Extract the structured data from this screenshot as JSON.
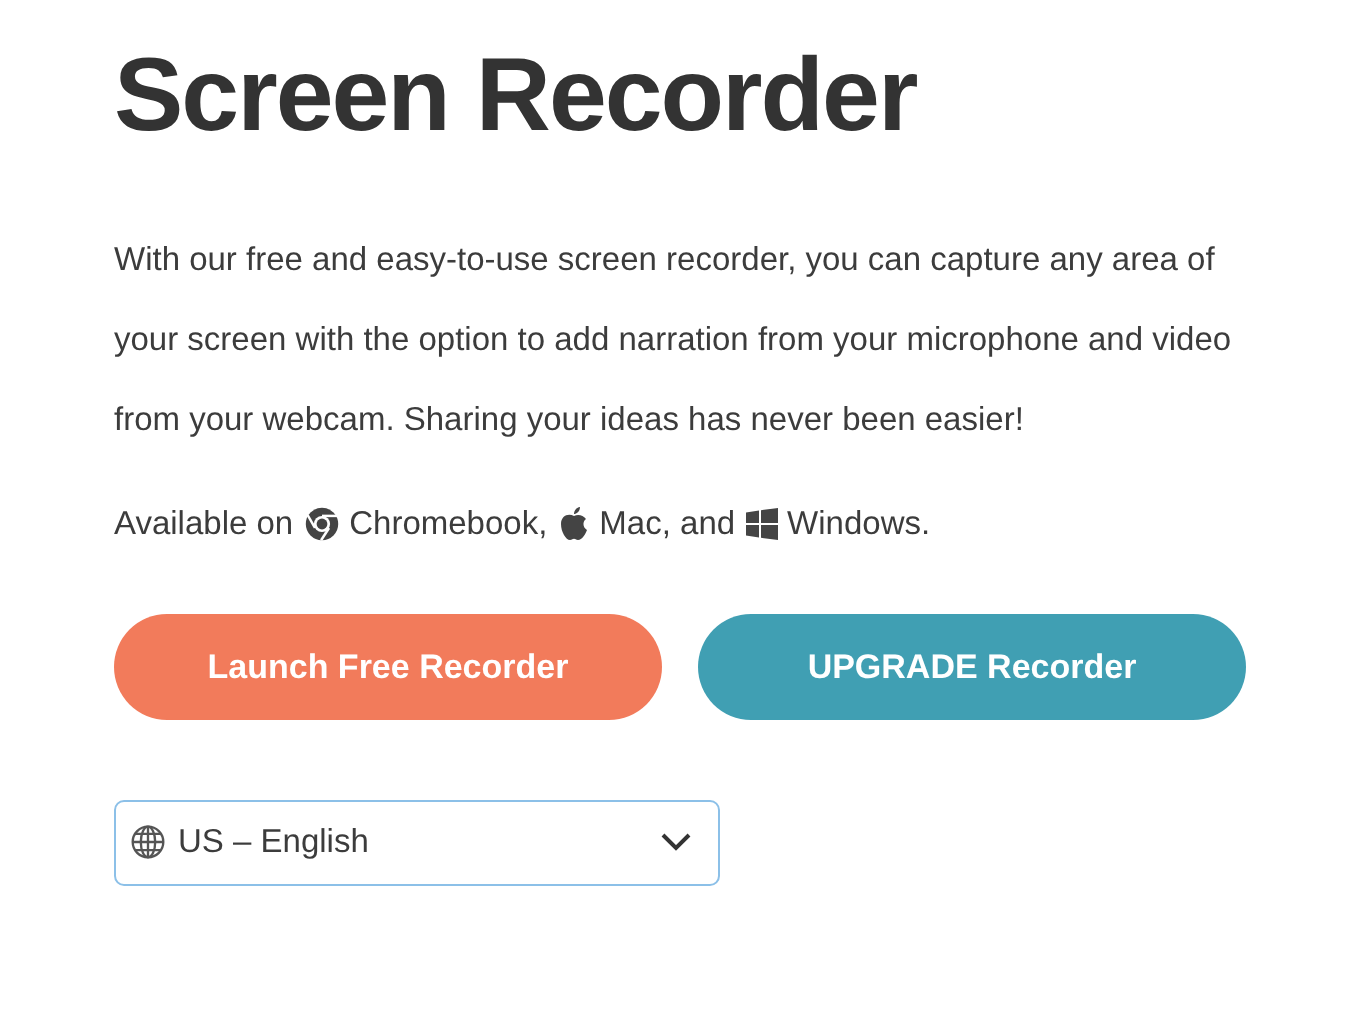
{
  "title": "Screen Recorder",
  "description": "With our free and easy-to-use screen recorder, you can capture any area of your screen with the option to add narration from your microphone and video from your webcam. Sharing your ideas has never been easier!",
  "availability": {
    "lead": "Available on",
    "platforms": [
      {
        "kind": "chrome",
        "label": "Chromebook,"
      },
      {
        "kind": "apple",
        "label": "Mac, and"
      },
      {
        "kind": "windows",
        "label": "Windows."
      }
    ]
  },
  "buttons": [
    {
      "label": "Launch Free Recorder",
      "color": "#f27b5b"
    },
    {
      "label": "UPGRADE Recorder",
      "color": "#409fb3"
    }
  ],
  "language_select": {
    "value": "US – English"
  }
}
